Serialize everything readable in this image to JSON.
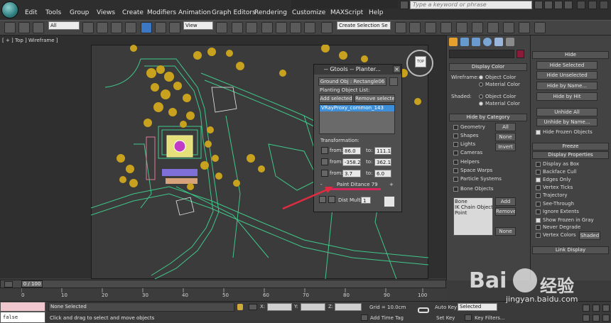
{
  "menu": [
    "Edit",
    "Tools",
    "Group",
    "Views",
    "Create",
    "Modifiers",
    "Animation",
    "Graph Editors",
    "Rendering",
    "Customize",
    "MAXScript",
    "Help"
  ],
  "search": {
    "placeholder": "Type a keyword or phrase"
  },
  "toolbar": {
    "filter": "All",
    "ref_coord": "View",
    "selection_set": "Create Selection Se"
  },
  "viewport": {
    "label": "[ + ] Top ] Wireframe ]",
    "viewcube": "TOP"
  },
  "gtools": {
    "title": "-- Gtools -- Planter...",
    "ground_obj": "Ground Obj : Rectangle06",
    "planting_list_label": "Planting Object List:",
    "add_selected": "Add selected",
    "remove_selected": "Remove selected",
    "list_item": "VRayProxy_common_143",
    "transformation_label": "Transformation:",
    "rows": [
      {
        "from": "86.0",
        "to": "111.1"
      },
      {
        "from": "-358.2",
        "to": "362.1"
      },
      {
        "from": "3.7",
        "to": "6.0"
      }
    ],
    "from_label": "from:",
    "to_label": "to:",
    "minus": "-",
    "plus": "+",
    "paint_distance": "Paint Ditance  79",
    "dist_multi": "Dist Multi.",
    "dist_value": "1"
  },
  "display_color": {
    "header": "Display Color",
    "wireframe_label": "Wireframe:",
    "shaded_label": "Shaded:",
    "object_color": "Object Color",
    "material_color": "Material Color"
  },
  "hide_by_category": {
    "header": "Hide by Category",
    "items": [
      "Geometry",
      "Shapes",
      "Lights",
      "Cameras",
      "Helpers",
      "Space Warps",
      "Particle Systems",
      "Bone Objects"
    ],
    "all": "All",
    "none": "None",
    "invert": "Invert",
    "list": [
      "Bone",
      "IK Chain Object",
      "Point"
    ],
    "add": "Add",
    "remove": "Remove",
    "none2": "None"
  },
  "hide": {
    "header": "Hide",
    "buttons": [
      "Hide Selected",
      "Hide Unselected",
      "Hide by Name...",
      "Hide by Hit",
      "Unhide All",
      "Unhide by Name..."
    ],
    "hide_frozen": "Hide Frozen Objects"
  },
  "freeze": {
    "header": "Freeze"
  },
  "display_properties": {
    "header": "Display Properties",
    "items": [
      "Display as Box",
      "Backface Cull",
      "Edges Only",
      "Vertex Ticks",
      "Trajectory",
      "See-Through",
      "Ignore Extents",
      "Show Frozen in Gray",
      "Never Degrade",
      "Vertex Colors"
    ],
    "checked": [
      false,
      false,
      true,
      false,
      false,
      false,
      false,
      true,
      false,
      false
    ],
    "shaded": "Shaded"
  },
  "link_display": {
    "header": "Link Display"
  },
  "timeline": {
    "frame": "0 / 100",
    "ticks": [
      "10",
      "20",
      "30",
      "40",
      "50",
      "60",
      "70",
      "80",
      "90",
      "100"
    ],
    "zero": "0"
  },
  "status": {
    "script": "false",
    "selection": "None Selected",
    "prompt": "Click and drag to select and move objects",
    "x": "X:",
    "y": "Y:",
    "z": "Z:",
    "grid": "Grid = 10.0cm",
    "add_time_tag": "Add Time Tag",
    "auto_key": "Auto Key",
    "set_key": "Set Key",
    "selected": "Selected",
    "key_filters": "Key Filters..."
  },
  "watermark": {
    "brand": "Bai",
    "brand2": "经验",
    "url": "jingyan.baidu.com"
  },
  "colors": {
    "dialog_selection": "#3c8fd8",
    "arrow": "#e02c40",
    "wire_green": "#3fc88a",
    "tree_yellow": "#c8a21e"
  }
}
